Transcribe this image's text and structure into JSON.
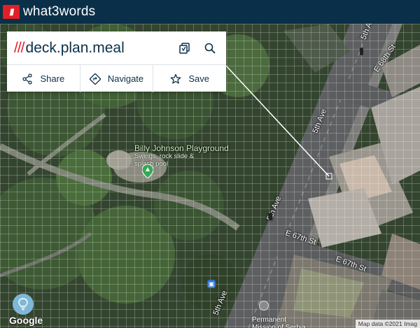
{
  "app": {
    "name": "what3words",
    "logo_mark": "///"
  },
  "card": {
    "slashes": "///",
    "address": "deck.plan.meal",
    "copy_icon": "copy-icon",
    "search_icon": "search-icon",
    "actions": [
      {
        "label": "Share",
        "icon": "share-icon"
      },
      {
        "label": "Navigate",
        "icon": "navigate-icon"
      },
      {
        "label": "Save",
        "icon": "star-icon"
      }
    ]
  },
  "map": {
    "poi": {
      "title": "Billy Johnson Playground",
      "subtitle": "Swings, rock slide & splash pool"
    },
    "streets": {
      "fifth_ave_top": "5th A",
      "e68th": "E 68th St",
      "fifth_ave_mid": "5th Ave",
      "fifth_ave_low": "5th Ave",
      "e67th_a": "E 67th St",
      "e67th_b": "E 67th St",
      "fifth_ave_bottom": "5th Ave"
    },
    "permanent_label": "Permanent\nMission of Serbia"
  },
  "footer": {
    "google": "Google",
    "attribution": "Map data ©2021 Imag"
  },
  "colors": {
    "brand_dark": "#0a3049",
    "brand_red": "#e11f26",
    "poi_green": "#34a853"
  }
}
